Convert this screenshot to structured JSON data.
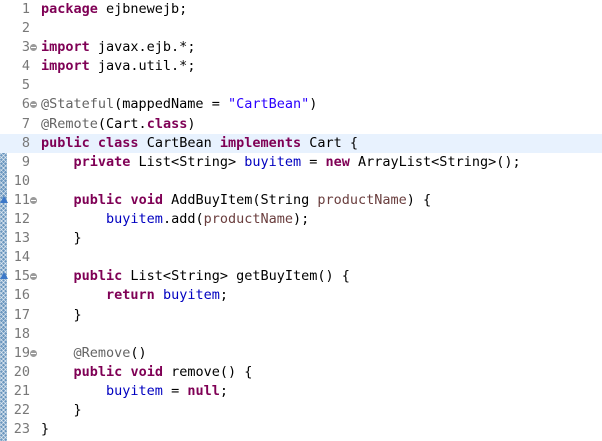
{
  "colors": {
    "keyword": "#7f0055",
    "annotation": "#646464",
    "string": "#2a00ff",
    "field": "#0000c0",
    "parameter": "#6a3e3e",
    "line_number": "#787878",
    "current_line": "#e8f2fe",
    "change_ruler": "#6a96be"
  },
  "lines": [
    {
      "n": "1",
      "tokens": [
        {
          "t": "package",
          "c": "kw"
        },
        {
          "t": " ejbnewejb;"
        }
      ]
    },
    {
      "n": "2",
      "tokens": []
    },
    {
      "n": "3",
      "fold": true,
      "tokens": [
        {
          "t": "import",
          "c": "kw"
        },
        {
          "t": " javax.ejb.*;"
        }
      ]
    },
    {
      "n": "4",
      "tokens": [
        {
          "t": "import",
          "c": "kw"
        },
        {
          "t": " java.util.*;"
        }
      ]
    },
    {
      "n": "5",
      "tokens": []
    },
    {
      "n": "6",
      "fold": true,
      "tokens": [
        {
          "t": "@Stateful",
          "c": "ann"
        },
        {
          "t": "(mappedName = "
        },
        {
          "t": "\"CartBean\"",
          "c": "str"
        },
        {
          "t": ")"
        }
      ]
    },
    {
      "n": "7",
      "tokens": [
        {
          "t": "@Remote",
          "c": "ann"
        },
        {
          "t": "(Cart."
        },
        {
          "t": "class",
          "c": "kw"
        },
        {
          "t": ")"
        }
      ]
    },
    {
      "n": "8",
      "current": true,
      "tokens": [
        {
          "t": "public",
          "c": "kw"
        },
        {
          "t": " "
        },
        {
          "t": "class",
          "c": "kw"
        },
        {
          "t": " CartBean "
        },
        {
          "t": "implements",
          "c": "kw"
        },
        {
          "t": " Cart {"
        }
      ]
    },
    {
      "n": "9",
      "tokens": [
        {
          "t": "    "
        },
        {
          "t": "private",
          "c": "kw"
        },
        {
          "t": " List<String> "
        },
        {
          "t": "buyitem",
          "c": "fld"
        },
        {
          "t": " = "
        },
        {
          "t": "new",
          "c": "kw"
        },
        {
          "t": " ArrayList<String>();"
        }
      ]
    },
    {
      "n": "10",
      "tokens": []
    },
    {
      "n": "11",
      "fold": true,
      "marker": "override",
      "tokens": [
        {
          "t": "    "
        },
        {
          "t": "public",
          "c": "kw"
        },
        {
          "t": " "
        },
        {
          "t": "void",
          "c": "kw"
        },
        {
          "t": " AddBuyItem(String "
        },
        {
          "t": "productName",
          "c": "par"
        },
        {
          "t": ") {"
        }
      ]
    },
    {
      "n": "12",
      "tokens": [
        {
          "t": "        "
        },
        {
          "t": "buyitem",
          "c": "fld"
        },
        {
          "t": ".add("
        },
        {
          "t": "productName",
          "c": "par"
        },
        {
          "t": ");"
        }
      ]
    },
    {
      "n": "13",
      "tokens": [
        {
          "t": "    }"
        }
      ]
    },
    {
      "n": "14",
      "tokens": []
    },
    {
      "n": "15",
      "fold": true,
      "marker": "override",
      "tokens": [
        {
          "t": "    "
        },
        {
          "t": "public",
          "c": "kw"
        },
        {
          "t": " List<String> getBuyItem() {"
        }
      ]
    },
    {
      "n": "16",
      "tokens": [
        {
          "t": "        "
        },
        {
          "t": "return",
          "c": "kw"
        },
        {
          "t": " "
        },
        {
          "t": "buyitem",
          "c": "fld"
        },
        {
          "t": ";"
        }
      ]
    },
    {
      "n": "17",
      "tokens": [
        {
          "t": "    }"
        }
      ]
    },
    {
      "n": "18",
      "tokens": []
    },
    {
      "n": "19",
      "fold": true,
      "tokens": [
        {
          "t": "    "
        },
        {
          "t": "@Remove",
          "c": "ann"
        },
        {
          "t": "()"
        }
      ]
    },
    {
      "n": "20",
      "tokens": [
        {
          "t": "    "
        },
        {
          "t": "public",
          "c": "kw"
        },
        {
          "t": " "
        },
        {
          "t": "void",
          "c": "kw"
        },
        {
          "t": " remove() {"
        }
      ]
    },
    {
      "n": "21",
      "tokens": [
        {
          "t": "        "
        },
        {
          "t": "buyitem",
          "c": "fld"
        },
        {
          "t": " = "
        },
        {
          "t": "null",
          "c": "kw"
        },
        {
          "t": ";"
        }
      ]
    },
    {
      "n": "22",
      "tokens": [
        {
          "t": "    }"
        }
      ]
    },
    {
      "n": "23",
      "tokens": [
        {
          "t": "}"
        }
      ]
    }
  ]
}
